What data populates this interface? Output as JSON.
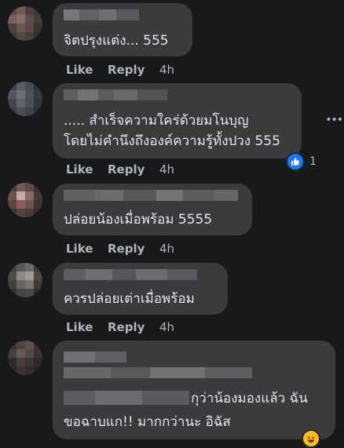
{
  "comments": [
    {
      "text_lines": [
        "จิตปรุงแต่ง... 555"
      ],
      "like": "Like",
      "reply": "Reply",
      "time": "4h"
    },
    {
      "text_lines": [
        "..... สำเร็จความใคร่ด้วยมโนบุญ",
        "โดยไม่คำนึงถึงองค์ความรู้ทั้งปวง 555"
      ],
      "like": "Like",
      "reply": "Reply",
      "time": "4h",
      "reaction": {
        "icon": "like-reaction-icon",
        "count": "1",
        "color": "#1877f2"
      }
    },
    {
      "text_lines": [
        "ปล่อยน้องเมื่อพร้อม 5555"
      ],
      "like": "Like",
      "reply": "Reply",
      "time": "4h"
    },
    {
      "text_lines": [
        "ควรปล่อยเต่าเมื่อพร้อม"
      ],
      "like": "Like",
      "reply": "Reply",
      "time": "4h"
    },
    {
      "text_lines": [
        "กุว่าน้องมองแล้ว ฉัน",
        "ขอฉาบแก!! มากกว่านะ อิฉัส"
      ],
      "reaction": {
        "icon": "haha-reaction-icon",
        "color": "#f7b928"
      }
    }
  ],
  "colors": {
    "background": "#18191a",
    "bubble": "#3a3b3c",
    "text": "#e4e6eb",
    "muted": "#b0b3b8"
  },
  "more_icon": "more-options-icon"
}
